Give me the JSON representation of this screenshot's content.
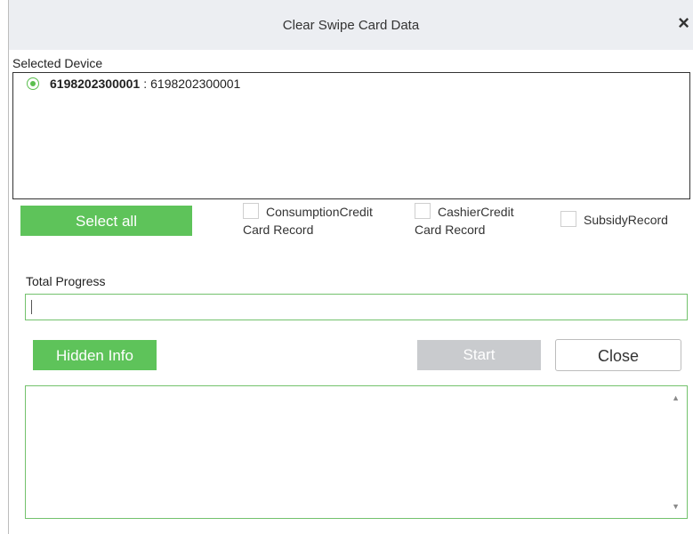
{
  "dialog": {
    "title": "Clear Swipe Card Data",
    "close_glyph": "×"
  },
  "devices": {
    "label": "Selected Device",
    "items": [
      {
        "id": "6198202300001",
        "separator": ":",
        "name": "6198202300001",
        "selected": true
      }
    ]
  },
  "actions": {
    "select_all": "Select all",
    "hidden_info": "Hidden Info",
    "start": "Start",
    "close": "Close"
  },
  "checkboxes": [
    {
      "line1": "ConsumptionCredit",
      "line2": "Card Record",
      "checked": false
    },
    {
      "line1": "CashierCredit",
      "line2": "Card Record",
      "checked": false
    },
    {
      "line1": "SubsidyRecord",
      "line2": "",
      "checked": false
    }
  ],
  "progress": {
    "label": "Total Progress",
    "value": 0
  },
  "info_area": {
    "content": "",
    "scroll_up_glyph": "▲",
    "scroll_down_glyph": "▼"
  },
  "colors": {
    "accent": "#5ec35a",
    "border_green": "#73c26d",
    "disabled": "#c9cbce",
    "titlebar": "#eceef2"
  }
}
